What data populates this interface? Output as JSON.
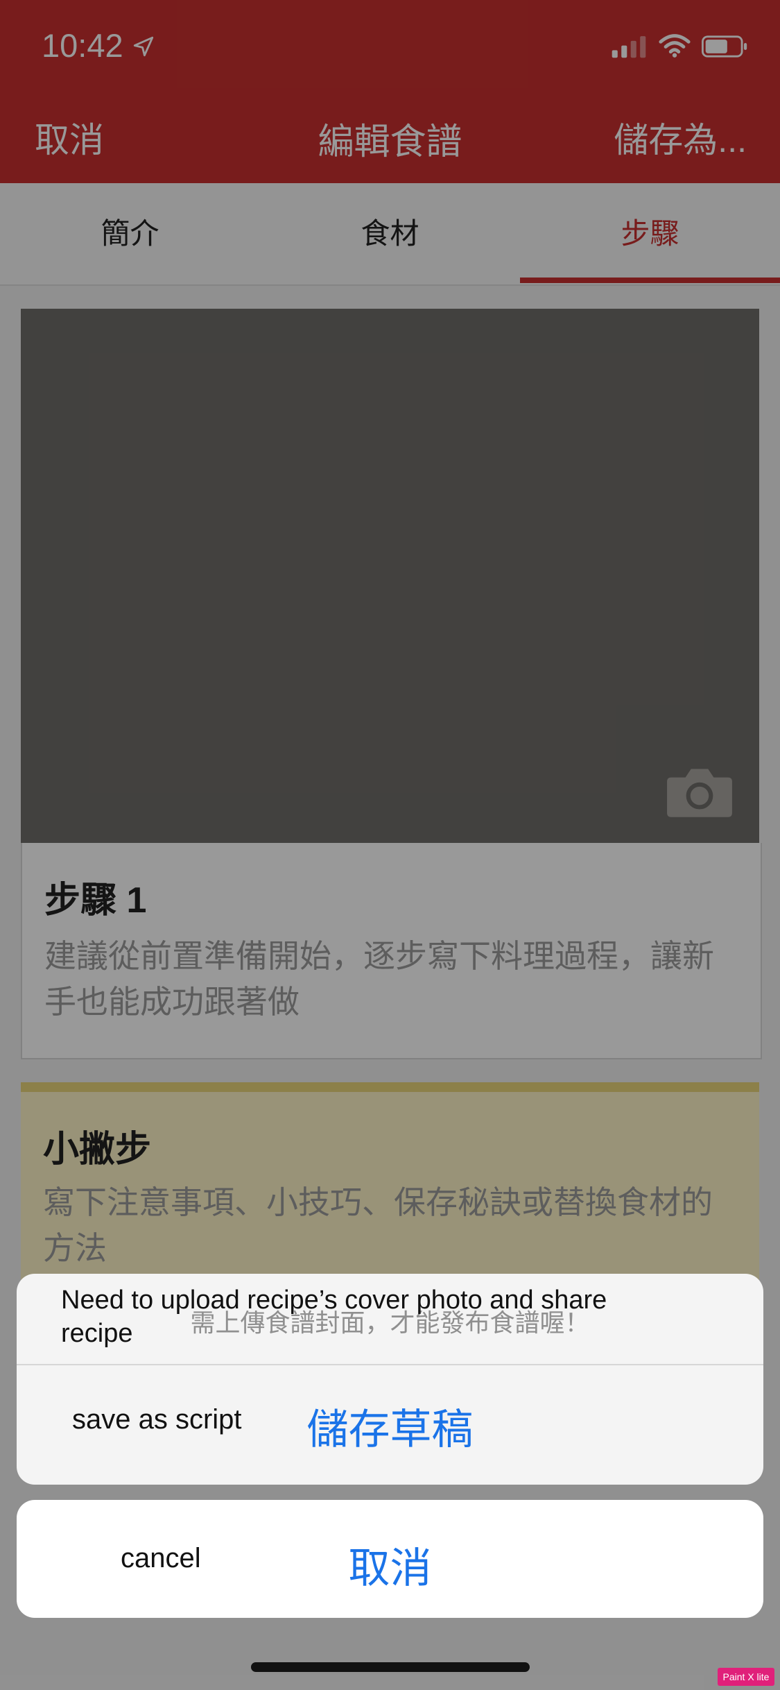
{
  "status_bar": {
    "time": "10:42"
  },
  "nav": {
    "cancel_label": "取消",
    "title": "編輯食譜",
    "save_label": "儲存為..."
  },
  "tabs": [
    {
      "label": "簡介"
    },
    {
      "label": "食材"
    },
    {
      "label": "步驟",
      "active": true
    }
  ],
  "step": {
    "title": "步驟 1",
    "placeholder": "建議從前置準備開始，逐步寫下料理過程，讓新手也能成功跟著做"
  },
  "tip": {
    "title": "小撇步",
    "placeholder": "寫下注意事項、小技巧、保存秘訣或替換食材的方法"
  },
  "action_sheet": {
    "message_en": "Need to upload recipe’s cover photo and share recipe",
    "message_zh": "需上傳食譜封面，才能發布食譜喔！",
    "save_draft_en": "save as script",
    "save_draft_zh": "儲存草稿",
    "cancel_en": "cancel",
    "cancel_zh": "取消"
  },
  "watermark": "Paint X lite",
  "colors": {
    "brand_red": "#c8302f",
    "action_blue": "#1a73e8",
    "tip_yellow": "#fff6c9"
  },
  "icons": {
    "location": "location-arrow-icon",
    "signal": "cellular-signal-icon",
    "wifi": "wifi-icon",
    "battery": "battery-icon",
    "camera": "camera-icon"
  }
}
